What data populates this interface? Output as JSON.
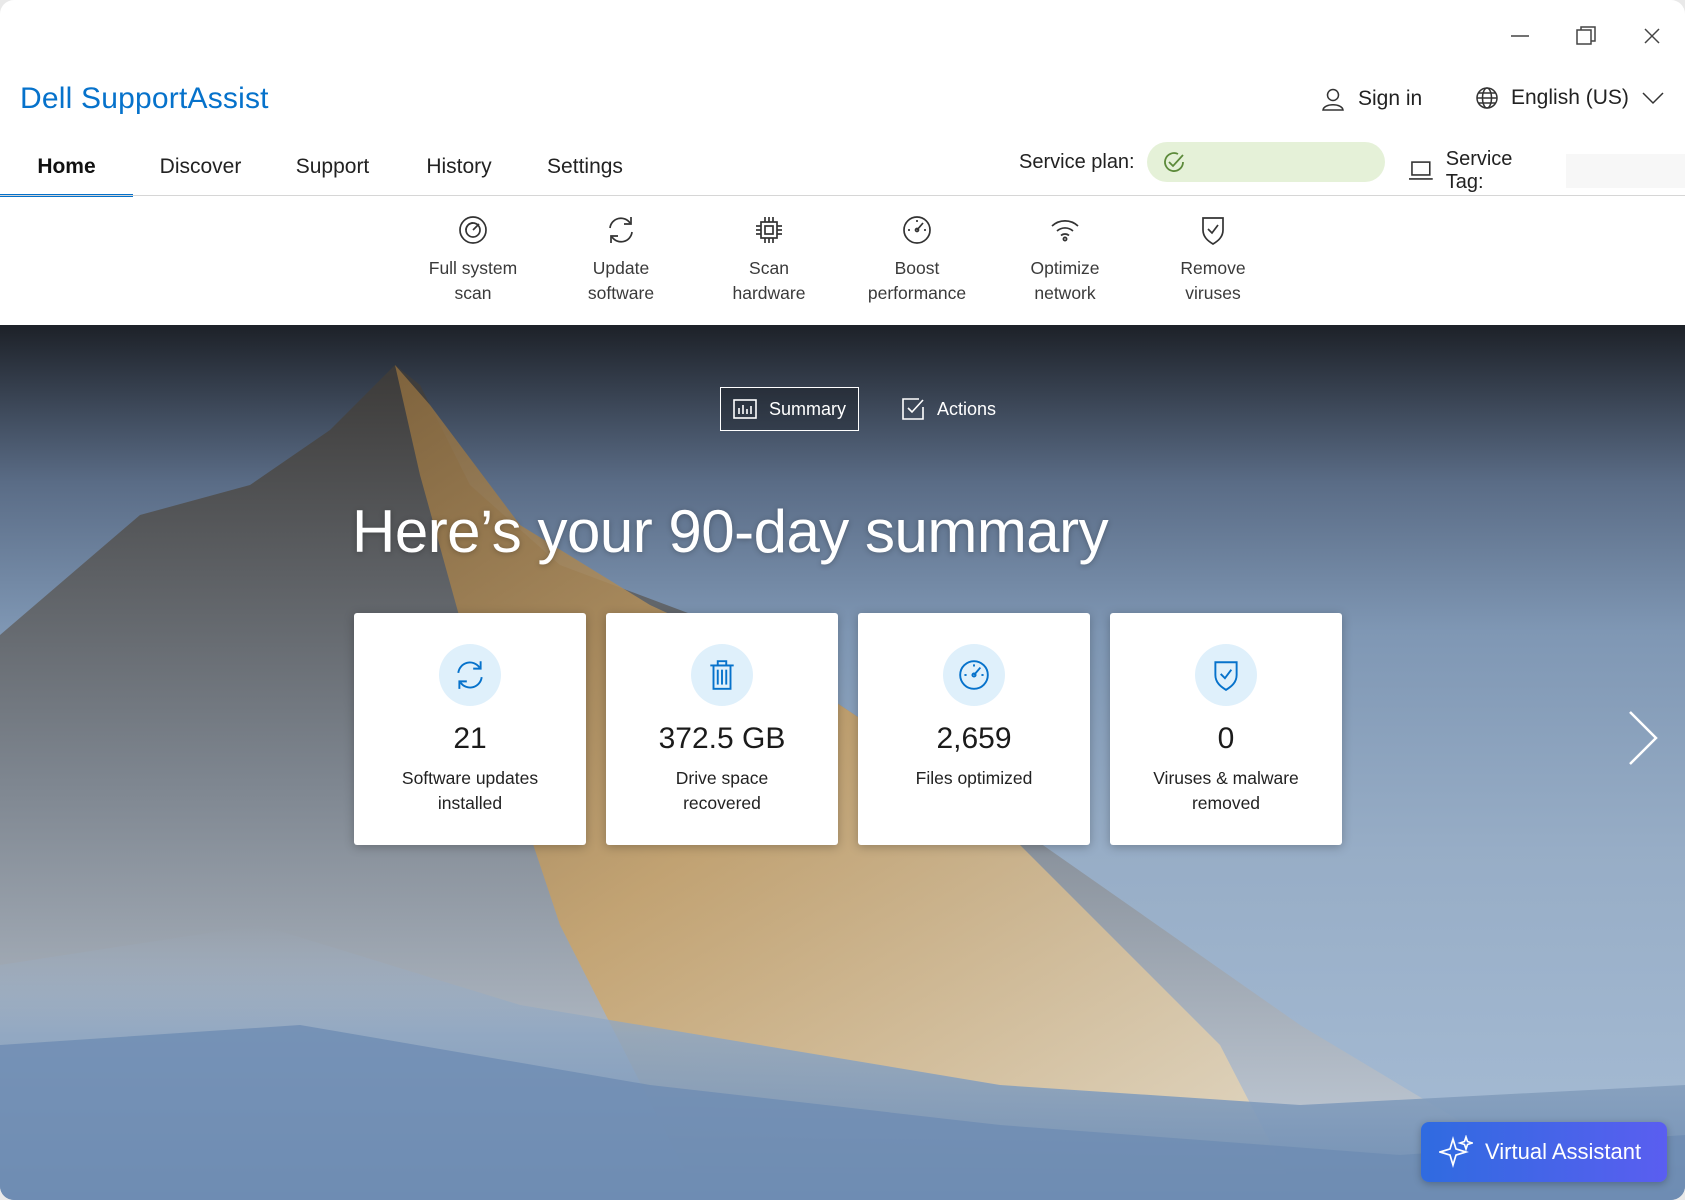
{
  "window": {
    "controls": [
      "minimize",
      "maximize",
      "close"
    ]
  },
  "app": {
    "title": "Dell SupportAssist"
  },
  "header": {
    "sign_in": "Sign in",
    "language": "English (US)",
    "service_plan_label": "Service plan:",
    "service_tag_label": "Service Tag:"
  },
  "tabs": [
    {
      "label": "Home",
      "active": true
    },
    {
      "label": "Discover",
      "active": false
    },
    {
      "label": "Support",
      "active": false
    },
    {
      "label": "History",
      "active": false
    },
    {
      "label": "Settings",
      "active": false
    }
  ],
  "quick_actions": [
    {
      "label": "Full system\nscan",
      "icon": "scan-icon"
    },
    {
      "label": "Update\nsoftware",
      "icon": "refresh-icon"
    },
    {
      "label": "Scan\nhardware",
      "icon": "chip-icon"
    },
    {
      "label": "Boost\nperformance",
      "icon": "gauge-icon"
    },
    {
      "label": "Optimize\nnetwork",
      "icon": "wifi-icon"
    },
    {
      "label": "Remove\nviruses",
      "icon": "shield-icon"
    }
  ],
  "hero": {
    "segments": [
      {
        "label": "Summary",
        "active": true,
        "icon": "chart-icon"
      },
      {
        "label": "Actions",
        "active": false,
        "icon": "checkbox-icon"
      }
    ],
    "title": "Here’s your 90-day summary",
    "cards": [
      {
        "value": "21",
        "label": "Software updates\ninstalled",
        "icon": "refresh-icon"
      },
      {
        "value": "372.5 GB",
        "label": "Drive space\nrecovered",
        "icon": "trash-icon"
      },
      {
        "value": "2,659",
        "label": "Files optimized",
        "icon": "gauge-icon"
      },
      {
        "value": "0",
        "label": "Viruses & malware\nremoved",
        "icon": "shield-icon"
      }
    ]
  },
  "assistant": {
    "label": "Virtual Assistant"
  },
  "colors": {
    "brand_blue": "#0672cb",
    "plan_pill": "#e5f1d8",
    "card_icon_bg": "#dff0fb"
  }
}
